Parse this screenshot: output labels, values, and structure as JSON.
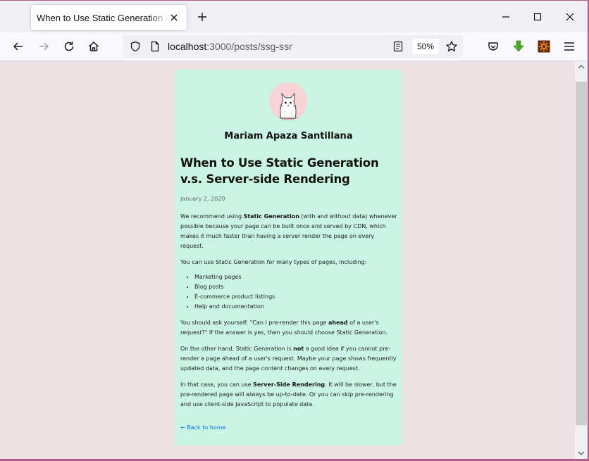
{
  "browser": {
    "tab_title": "When to Use Static Generation v.s. Server-side Rendering",
    "url_host": "localhost",
    "url_rest": ":3000/posts/ssg-ssr",
    "zoom": "50%"
  },
  "post": {
    "author": "Mariam Apaza Santillana",
    "title": "When to Use Static Generation v.s. Server-side Rendering",
    "date": "January 2, 2020",
    "p1": {
      "a": "We recommend using ",
      "b": "Static Generation",
      "c": " (with and without data) whenever possible because your page can be built once and served by CDN, which makes it much faster than having a server render the page on every request."
    },
    "p2": "You can use Static Generation for many types of pages, including:",
    "list": [
      "Marketing pages",
      "Blog posts",
      "E-commerce product listings",
      "Help and documentation"
    ],
    "p3": {
      "a": "You should ask yourself: \"Can I pre-render this page ",
      "b": "ahead",
      "c": " of a user's request?\" If the answer is yes, then you should choose Static Generation."
    },
    "p4": {
      "a": "On the other hand, Static Generation is ",
      "b": "not",
      "c": " a good idea if you cannot pre-render a page ahead of a user's request. Maybe your page shows frequently updated data, and the page content changes on every request."
    },
    "p5": {
      "a": "In that case, you can use ",
      "b": "Server-Side Rendering",
      "c": ". It will be slower, but the pre-rendered page will always be up-to-date. Or you can skip pre-rendering and use client-side JavaScript to populate data."
    },
    "back_link": "← Back to home"
  },
  "icons": {
    "tab_close": "close-icon",
    "new_tab": "plus-icon",
    "back": "arrow-left-icon",
    "forward": "arrow-right-icon",
    "reload": "reload-icon",
    "home": "home-icon",
    "shield": "shield-icon",
    "page": "page-icon",
    "reader": "reader-view-icon",
    "bookmark": "star-icon",
    "pocket": "pocket-icon",
    "download": "download-arrow-icon",
    "extension": "sun-gear-icon",
    "menu": "hamburger-menu-icon"
  },
  "colors": {
    "page_bg": "#ede1e2",
    "card_bg": "#c9f5e2",
    "link": "#0070f3",
    "avatar_bg": "#f9d4d6",
    "window_border": "#b45b8e"
  }
}
